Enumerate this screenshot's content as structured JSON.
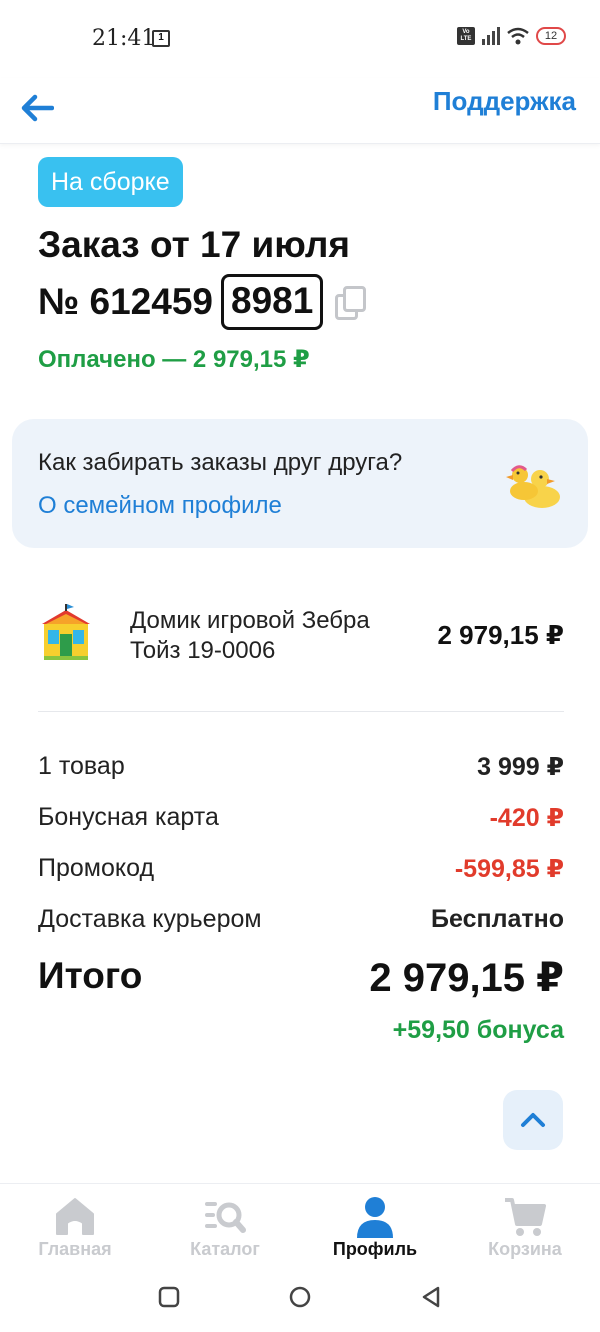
{
  "status_bar": {
    "time": "21:41",
    "notification_count": "1",
    "network": "Vo LTE",
    "battery": "12"
  },
  "header": {
    "support_label": "Поддержка"
  },
  "order": {
    "status_tag": "На сборке",
    "title": "Заказ от 17 июля",
    "number_prefix": "№ 612459",
    "number_code": "8981",
    "paid_text": "Оплачено — 2 979,15 ₽"
  },
  "family_card": {
    "question": "Как забирать заказы друг друга?",
    "link": "О семейном профиле"
  },
  "item": {
    "name": "Домик игровой Зебра Тойз 19-0006",
    "price": "2 979,15 ₽"
  },
  "summary": {
    "rows": [
      {
        "label": "1 товар",
        "value": "3 999 ₽",
        "color": "#111111"
      },
      {
        "label": "Бонусная карта",
        "value": "-420 ₽",
        "color": "#e13b2b"
      },
      {
        "label": "Промокод",
        "value": "-599,85 ₽",
        "color": "#e13b2b"
      },
      {
        "label": "Доставка курьером",
        "value": "Бесплатно",
        "color": "#111111"
      }
    ],
    "total_label": "Итого",
    "total_value": "2 979,15 ₽",
    "bonus": "+59,50 бонуса"
  },
  "bottom_nav": {
    "items": [
      {
        "label": "Главная",
        "icon": "home-icon"
      },
      {
        "label": "Каталог",
        "icon": "catalog-search-icon"
      },
      {
        "label": "Профиль",
        "icon": "profile-icon",
        "active": true
      },
      {
        "label": "Корзина",
        "icon": "cart-icon"
      }
    ]
  },
  "colors": {
    "accent": "#1f7fd6",
    "tag": "#39c1f0",
    "success": "#1f9e45",
    "discount": "#e13b2b"
  }
}
